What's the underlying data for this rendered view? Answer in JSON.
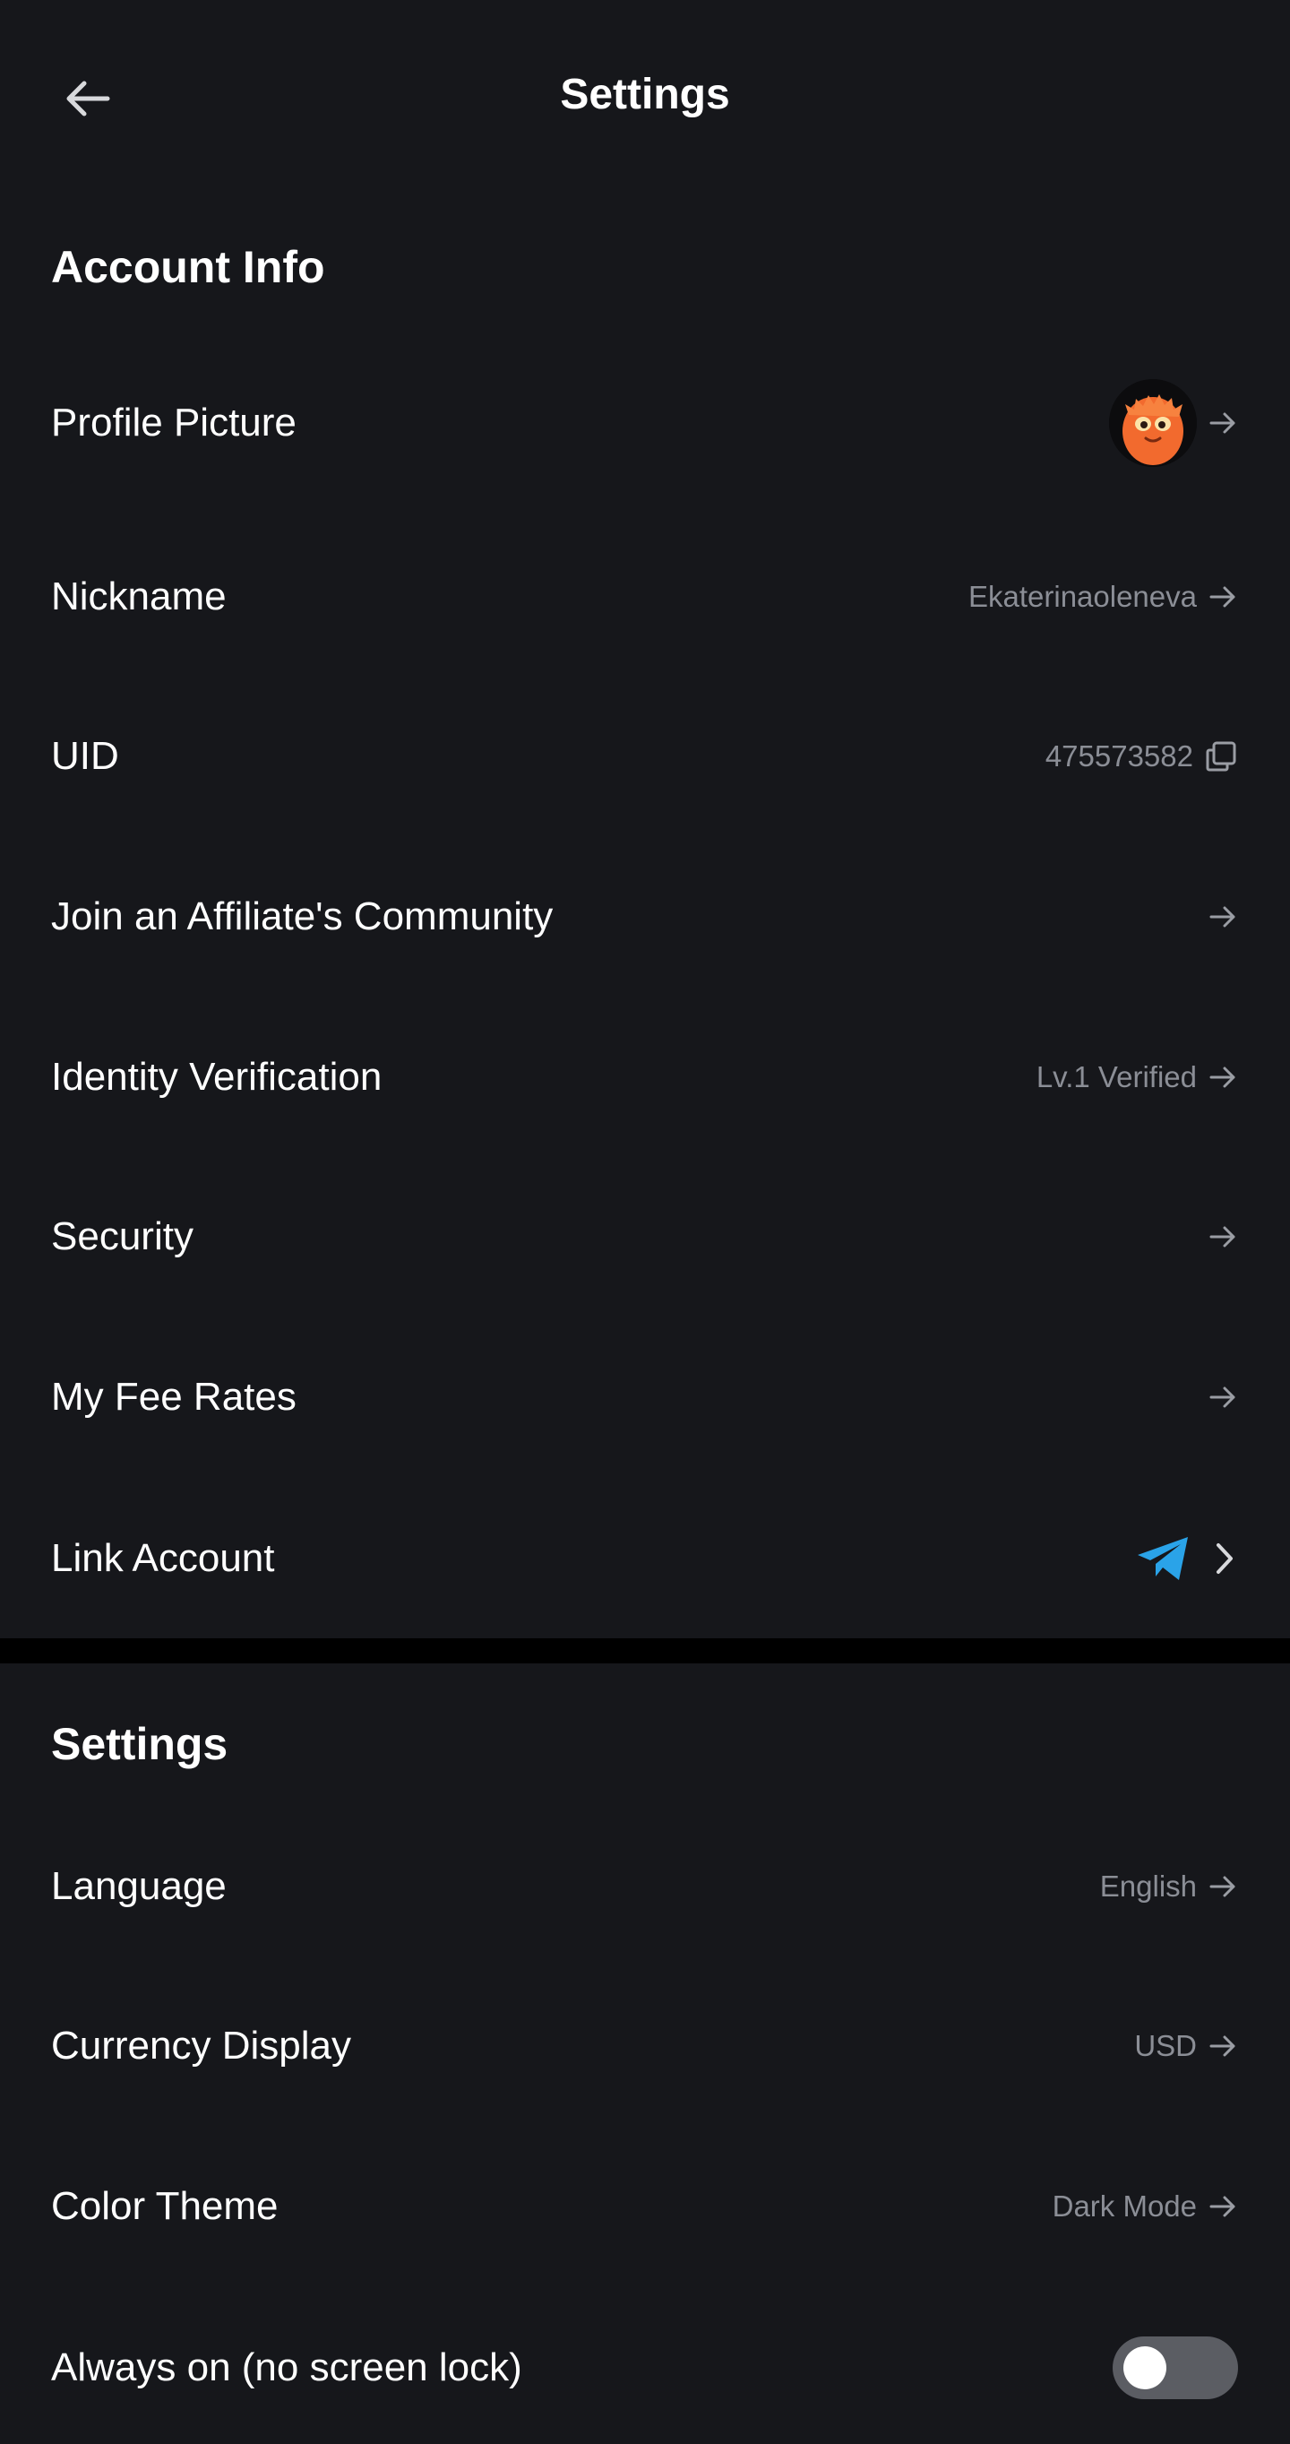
{
  "header": {
    "title": "Settings",
    "back_icon": "arrow-left-icon"
  },
  "account_info": {
    "section_title": "Account Info",
    "rows": {
      "profile_picture": {
        "label": "Profile Picture",
        "icon": "arrow-right-icon"
      },
      "nickname": {
        "label": "Nickname",
        "value": "Ekaterinaoleneva",
        "icon": "arrow-right-icon"
      },
      "uid": {
        "label": "UID",
        "value": "475573582",
        "icon": "copy-icon"
      },
      "affiliate": {
        "label": "Join an Affiliate's Community",
        "icon": "arrow-right-icon"
      },
      "identity": {
        "label": "Identity Verification",
        "value": "Lv.1 Verified",
        "icon": "arrow-right-icon"
      },
      "security": {
        "label": "Security",
        "icon": "arrow-right-icon"
      },
      "fee_rates": {
        "label": "My Fee Rates",
        "icon": "arrow-right-icon"
      },
      "link_account": {
        "label": "Link Account",
        "icon": "telegram-icon"
      }
    }
  },
  "settings": {
    "section_title": "Settings",
    "rows": {
      "language": {
        "label": "Language",
        "value": "English"
      },
      "currency": {
        "label": "Currency Display",
        "value": "USD"
      },
      "theme": {
        "label": "Color Theme",
        "value": "Dark Mode"
      },
      "always_on": {
        "label": "Always on (no screen lock)",
        "enabled": false
      }
    }
  },
  "colors": {
    "background": "#16171b",
    "text_primary": "#ffffff",
    "text_secondary": "#8b8e96",
    "telegram_blue": "#2aa3e8",
    "toggle_off": "#5b5d63",
    "avatar_orange": "#f26a2e"
  }
}
